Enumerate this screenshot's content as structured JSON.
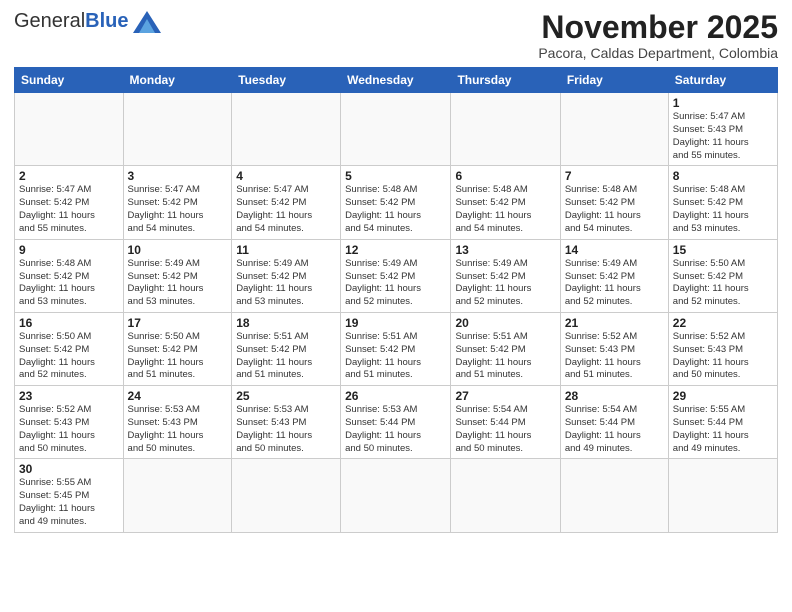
{
  "header": {
    "logo_general": "General",
    "logo_blue": "Blue",
    "month_title": "November 2025",
    "subtitle": "Pacora, Caldas Department, Colombia"
  },
  "weekdays": [
    "Sunday",
    "Monday",
    "Tuesday",
    "Wednesday",
    "Thursday",
    "Friday",
    "Saturday"
  ],
  "weeks": [
    [
      {
        "day": "",
        "info": ""
      },
      {
        "day": "",
        "info": ""
      },
      {
        "day": "",
        "info": ""
      },
      {
        "day": "",
        "info": ""
      },
      {
        "day": "",
        "info": ""
      },
      {
        "day": "",
        "info": ""
      },
      {
        "day": "1",
        "info": "Sunrise: 5:47 AM\nSunset: 5:43 PM\nDaylight: 11 hours\nand 55 minutes."
      }
    ],
    [
      {
        "day": "2",
        "info": "Sunrise: 5:47 AM\nSunset: 5:42 PM\nDaylight: 11 hours\nand 55 minutes."
      },
      {
        "day": "3",
        "info": "Sunrise: 5:47 AM\nSunset: 5:42 PM\nDaylight: 11 hours\nand 54 minutes."
      },
      {
        "day": "4",
        "info": "Sunrise: 5:47 AM\nSunset: 5:42 PM\nDaylight: 11 hours\nand 54 minutes."
      },
      {
        "day": "5",
        "info": "Sunrise: 5:48 AM\nSunset: 5:42 PM\nDaylight: 11 hours\nand 54 minutes."
      },
      {
        "day": "6",
        "info": "Sunrise: 5:48 AM\nSunset: 5:42 PM\nDaylight: 11 hours\nand 54 minutes."
      },
      {
        "day": "7",
        "info": "Sunrise: 5:48 AM\nSunset: 5:42 PM\nDaylight: 11 hours\nand 54 minutes."
      },
      {
        "day": "8",
        "info": "Sunrise: 5:48 AM\nSunset: 5:42 PM\nDaylight: 11 hours\nand 53 minutes."
      }
    ],
    [
      {
        "day": "9",
        "info": "Sunrise: 5:48 AM\nSunset: 5:42 PM\nDaylight: 11 hours\nand 53 minutes."
      },
      {
        "day": "10",
        "info": "Sunrise: 5:49 AM\nSunset: 5:42 PM\nDaylight: 11 hours\nand 53 minutes."
      },
      {
        "day": "11",
        "info": "Sunrise: 5:49 AM\nSunset: 5:42 PM\nDaylight: 11 hours\nand 53 minutes."
      },
      {
        "day": "12",
        "info": "Sunrise: 5:49 AM\nSunset: 5:42 PM\nDaylight: 11 hours\nand 52 minutes."
      },
      {
        "day": "13",
        "info": "Sunrise: 5:49 AM\nSunset: 5:42 PM\nDaylight: 11 hours\nand 52 minutes."
      },
      {
        "day": "14",
        "info": "Sunrise: 5:49 AM\nSunset: 5:42 PM\nDaylight: 11 hours\nand 52 minutes."
      },
      {
        "day": "15",
        "info": "Sunrise: 5:50 AM\nSunset: 5:42 PM\nDaylight: 11 hours\nand 52 minutes."
      }
    ],
    [
      {
        "day": "16",
        "info": "Sunrise: 5:50 AM\nSunset: 5:42 PM\nDaylight: 11 hours\nand 52 minutes."
      },
      {
        "day": "17",
        "info": "Sunrise: 5:50 AM\nSunset: 5:42 PM\nDaylight: 11 hours\nand 51 minutes."
      },
      {
        "day": "18",
        "info": "Sunrise: 5:51 AM\nSunset: 5:42 PM\nDaylight: 11 hours\nand 51 minutes."
      },
      {
        "day": "19",
        "info": "Sunrise: 5:51 AM\nSunset: 5:42 PM\nDaylight: 11 hours\nand 51 minutes."
      },
      {
        "day": "20",
        "info": "Sunrise: 5:51 AM\nSunset: 5:42 PM\nDaylight: 11 hours\nand 51 minutes."
      },
      {
        "day": "21",
        "info": "Sunrise: 5:52 AM\nSunset: 5:43 PM\nDaylight: 11 hours\nand 51 minutes."
      },
      {
        "day": "22",
        "info": "Sunrise: 5:52 AM\nSunset: 5:43 PM\nDaylight: 11 hours\nand 50 minutes."
      }
    ],
    [
      {
        "day": "23",
        "info": "Sunrise: 5:52 AM\nSunset: 5:43 PM\nDaylight: 11 hours\nand 50 minutes."
      },
      {
        "day": "24",
        "info": "Sunrise: 5:53 AM\nSunset: 5:43 PM\nDaylight: 11 hours\nand 50 minutes."
      },
      {
        "day": "25",
        "info": "Sunrise: 5:53 AM\nSunset: 5:43 PM\nDaylight: 11 hours\nand 50 minutes."
      },
      {
        "day": "26",
        "info": "Sunrise: 5:53 AM\nSunset: 5:44 PM\nDaylight: 11 hours\nand 50 minutes."
      },
      {
        "day": "27",
        "info": "Sunrise: 5:54 AM\nSunset: 5:44 PM\nDaylight: 11 hours\nand 50 minutes."
      },
      {
        "day": "28",
        "info": "Sunrise: 5:54 AM\nSunset: 5:44 PM\nDaylight: 11 hours\nand 49 minutes."
      },
      {
        "day": "29",
        "info": "Sunrise: 5:55 AM\nSunset: 5:44 PM\nDaylight: 11 hours\nand 49 minutes."
      }
    ],
    [
      {
        "day": "30",
        "info": "Sunrise: 5:55 AM\nSunset: 5:45 PM\nDaylight: 11 hours\nand 49 minutes."
      },
      {
        "day": "",
        "info": ""
      },
      {
        "day": "",
        "info": ""
      },
      {
        "day": "",
        "info": ""
      },
      {
        "day": "",
        "info": ""
      },
      {
        "day": "",
        "info": ""
      },
      {
        "day": "",
        "info": ""
      }
    ]
  ]
}
